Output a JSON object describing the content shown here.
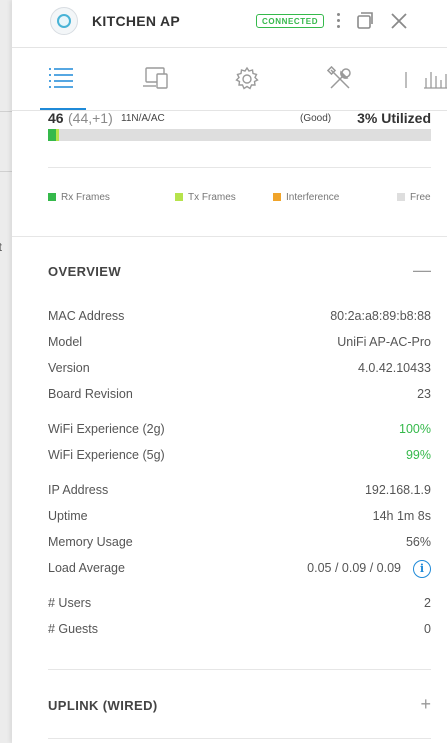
{
  "background_page": {
    "fragment_text": "ut"
  },
  "header": {
    "title": "KITCHEN AP",
    "status_badge": "CONNECTED",
    "icons": [
      "device-icon",
      "kebab-menu-icon",
      "restore-icon",
      "close-icon"
    ]
  },
  "tabs": [
    {
      "name": "details",
      "icon": "list-icon",
      "active": true
    },
    {
      "name": "clients",
      "icon": "devices-icon",
      "active": false
    },
    {
      "name": "configuration",
      "icon": "gear-icon",
      "active": false
    },
    {
      "name": "tools",
      "icon": "tools-icon",
      "active": false
    },
    {
      "name": "statistics",
      "icon": "bar-chart-icon",
      "active": false
    }
  ],
  "radio_stats": {
    "clients_count": "46",
    "clients_detail": "(44,+1)",
    "mode": "11N/A/AC",
    "quality": "(Good)",
    "utilization": "3% Utilized",
    "utilization_percent": 3,
    "bar_segments": [
      {
        "name": "rx-frames",
        "fraction": 0.02,
        "color": "#35b94b"
      },
      {
        "name": "tx-frames",
        "fraction": 0.01,
        "color": "#b6e34c"
      }
    ]
  },
  "legend": [
    {
      "label": "Rx Frames",
      "color": "#35b94b"
    },
    {
      "label": "Tx Frames",
      "color": "#b6e34c"
    },
    {
      "label": "Interference",
      "color": "#f0a42a"
    },
    {
      "label": "Free",
      "color": "#dedede"
    }
  ],
  "overview": {
    "title": "OVERVIEW",
    "toggle": "—",
    "rows": [
      {
        "key": "MAC Address",
        "value": "80:2a:a8:89:b8:88"
      },
      {
        "key": "Model",
        "value": "UniFi AP-AC-Pro"
      },
      {
        "key": "Version",
        "value": "4.0.42.10433"
      },
      {
        "key": "Board Revision",
        "value": "23"
      },
      {
        "key": "WiFi Experience (2g)",
        "value": "100%"
      },
      {
        "key": "WiFi Experience (5g)",
        "value": "99%"
      },
      {
        "key": "IP Address",
        "value": "192.168.1.9"
      },
      {
        "key": "Uptime",
        "value": "14h 1m 8s"
      },
      {
        "key": "Memory Usage",
        "value": "56%"
      },
      {
        "key": "Load Average",
        "value": "0.05 / 0.09 / 0.09"
      },
      {
        "key": "# Users",
        "value": "2"
      },
      {
        "key": "# Guests",
        "value": "0"
      }
    ],
    "info_icon_glyph": "i"
  },
  "uplink": {
    "title": "UPLINK (WIRED)",
    "toggle": "+"
  },
  "colors": {
    "accent": "#1f8ad8",
    "good": "#35b94b"
  }
}
